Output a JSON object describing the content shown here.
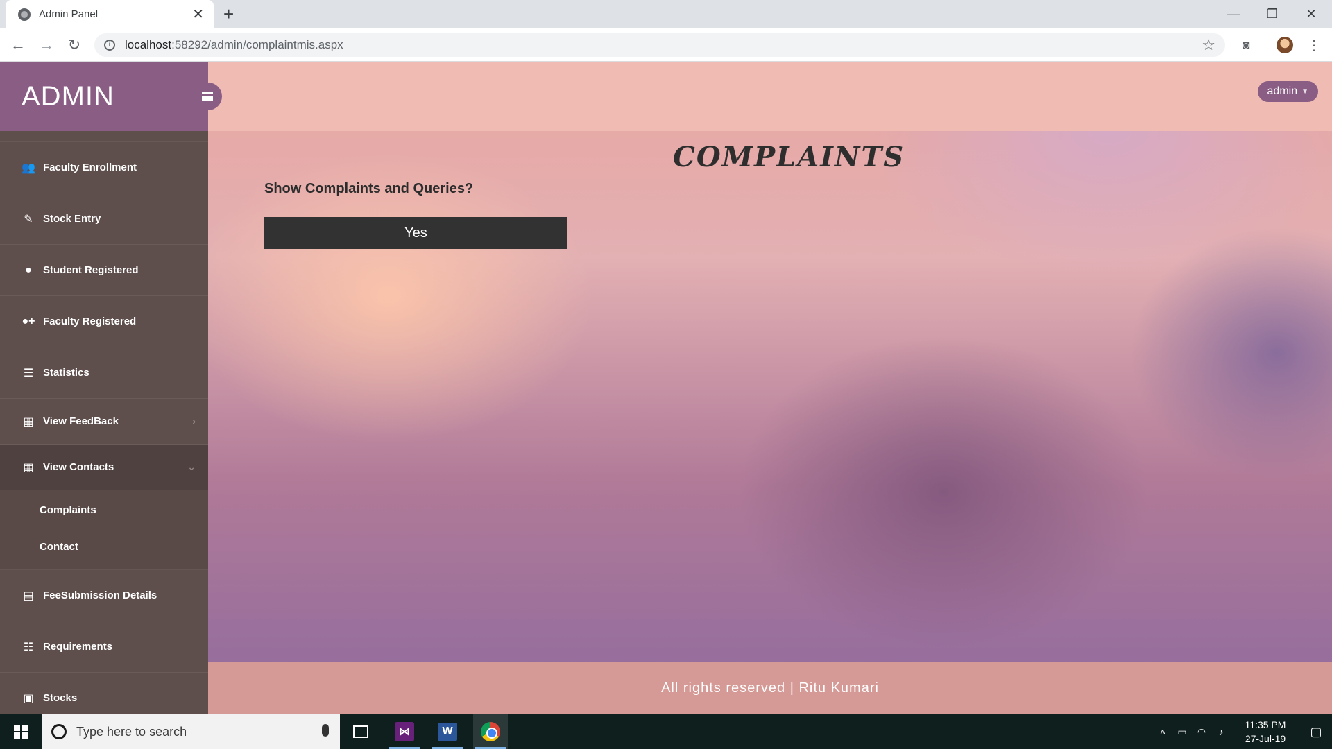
{
  "browser": {
    "tab_title": "Admin Panel",
    "new_tab": "+",
    "url_host": "localhost",
    "url_rest": ":58292/admin/complaintmis.aspx",
    "window_controls": {
      "minimize": "—",
      "restore": "❐",
      "close": "✕"
    }
  },
  "sidebar": {
    "brand": "ADMIN",
    "items": [
      {
        "label": "Faculty Enrollment",
        "icon": "users-icon"
      },
      {
        "label": "Stock Entry",
        "icon": "edit-icon"
      },
      {
        "label": "Student Registered",
        "icon": "user-icon"
      },
      {
        "label": "Faculty Registered",
        "icon": "user-plus-icon"
      },
      {
        "label": "Statistics",
        "icon": "list-icon"
      },
      {
        "label": "View FeedBack",
        "icon": "grid-icon"
      },
      {
        "label": "View Contacts",
        "icon": "grid-icon"
      },
      {
        "label": "FeeSubmission Details",
        "icon": "book-icon"
      },
      {
        "label": "Requirements",
        "icon": "list-alt-icon"
      },
      {
        "label": "Stocks",
        "icon": "briefcase-icon"
      }
    ],
    "sub_items": [
      {
        "label": "Complaints"
      },
      {
        "label": "Contact"
      }
    ]
  },
  "topbar": {
    "user_label": "admin"
  },
  "main": {
    "heading": "COMPLAINTS",
    "question": "Show Complaints and Queries?",
    "yes_button": "Yes"
  },
  "footer": {
    "text": "All rights reserved | Ritu Kumari"
  },
  "taskbar": {
    "search_placeholder": "Type here to search",
    "time": "11:35 PM",
    "date": "27-Jul-19"
  }
}
